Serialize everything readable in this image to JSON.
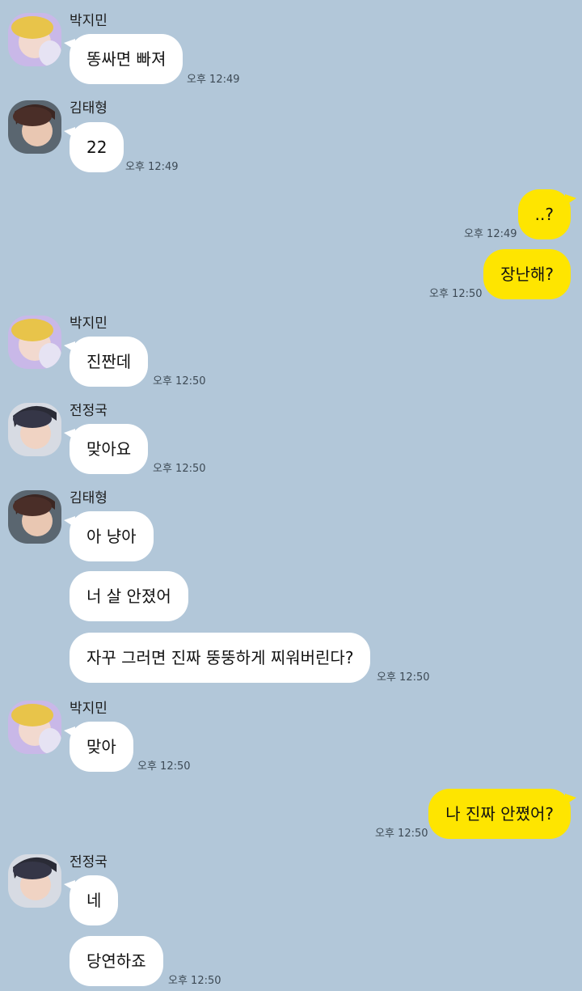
{
  "messages": [
    {
      "sender": "박지민",
      "text": "똥싸면 빠져",
      "time": "오후 12:49"
    },
    {
      "sender": "김태형",
      "text": "22",
      "time": "오후 12:49"
    },
    {
      "text": "..?",
      "time": "오후 12:49"
    },
    {
      "text": "장난해?",
      "time": "오후 12:50"
    },
    {
      "sender": "박지민",
      "text": "진짠데",
      "time": "오후 12:50"
    },
    {
      "sender": "전정국",
      "text": "맞아요",
      "time": "오후 12:50"
    },
    {
      "sender": "김태형",
      "text1": "아 냥아",
      "text2": "너 살 안졌어",
      "text3": "자꾸 그러면 진짜 뚱뚱하게 찌워버린다?",
      "time": "오후 12:50"
    },
    {
      "sender": "박지민",
      "text": "맞아",
      "time": "오후 12:50"
    },
    {
      "text": "나 진짜 안쪘어?",
      "time": "오후 12:50"
    },
    {
      "sender": "전정국",
      "text1": "네",
      "text2": "당연하죠",
      "time": "오후 12:50"
    }
  ],
  "colors": {
    "background": "#b2c7d9",
    "incoming": "#ffffff",
    "outgoing": "#fee500"
  }
}
